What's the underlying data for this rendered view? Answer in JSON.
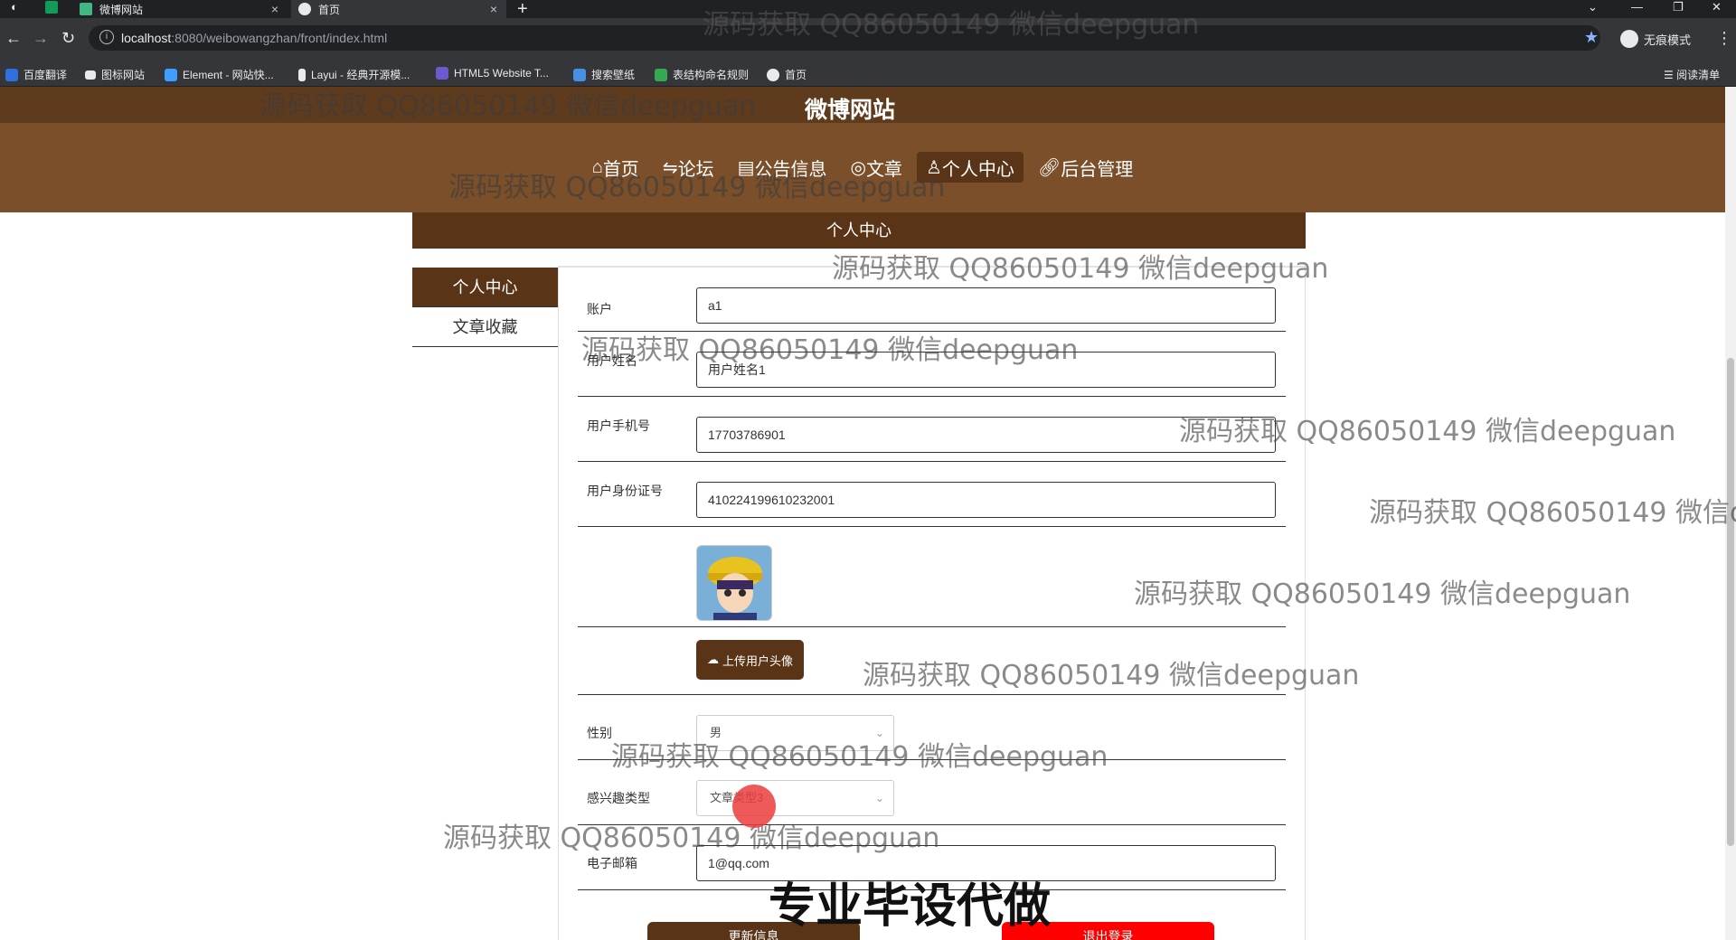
{
  "browser": {
    "tabs": [
      {
        "label": "微博网站",
        "active": false
      },
      {
        "label": "首页",
        "active": true
      }
    ],
    "url_host": "localhost",
    "url_rest": ":8080/weibowangzhan/front/index.html",
    "incognito_label": "无痕模式",
    "bookmarks": [
      "百度翻译",
      "图标网站",
      "Element - 网站快...",
      "Layui - 经典开源模...",
      "HTML5 Website T...",
      "搜索壁纸",
      "表结构命名规则",
      "首页"
    ],
    "reading_list": "阅读清单"
  },
  "site": {
    "title": "微博网站",
    "nav": [
      {
        "label": "首页",
        "icon": "home-icon",
        "active": false
      },
      {
        "label": "论坛",
        "icon": "forum-icon",
        "active": false
      },
      {
        "label": "公告信息",
        "icon": "notice-icon",
        "active": false
      },
      {
        "label": "文章",
        "icon": "article-icon",
        "active": false
      },
      {
        "label": "个人中心",
        "icon": "user-icon",
        "active": true
      },
      {
        "label": "后台管理",
        "icon": "link-icon",
        "active": false
      }
    ],
    "section_title": "个人中心"
  },
  "sidebar": {
    "items": [
      {
        "label": "个人中心",
        "active": true
      },
      {
        "label": "文章收藏",
        "active": false
      }
    ]
  },
  "form": {
    "account_label": "账户",
    "account_value": "a1",
    "name_label": "用户姓名",
    "name_value": "用户姓名1",
    "phone_label": "用户手机号",
    "phone_value": "17703786901",
    "idcard_label": "用户身份证号",
    "idcard_value": "410224199610232001",
    "upload_label": "上传用户头像",
    "gender_label": "性别",
    "gender_value": "男",
    "interest_label": "感兴趣类型",
    "interest_value": "文章类型3",
    "email_label": "电子邮箱",
    "email_value": "1@qq.com",
    "update_button": "更新信息",
    "logout_button": "退出登录"
  },
  "watermarks": {
    "text": "源码获取 QQ86050149 微信deepguan",
    "big_text": "专业毕设代做"
  },
  "colors": {
    "brand_brown": "#5a3417",
    "header_brown": "#7a4f2a",
    "logout_red": "#ff0000"
  }
}
